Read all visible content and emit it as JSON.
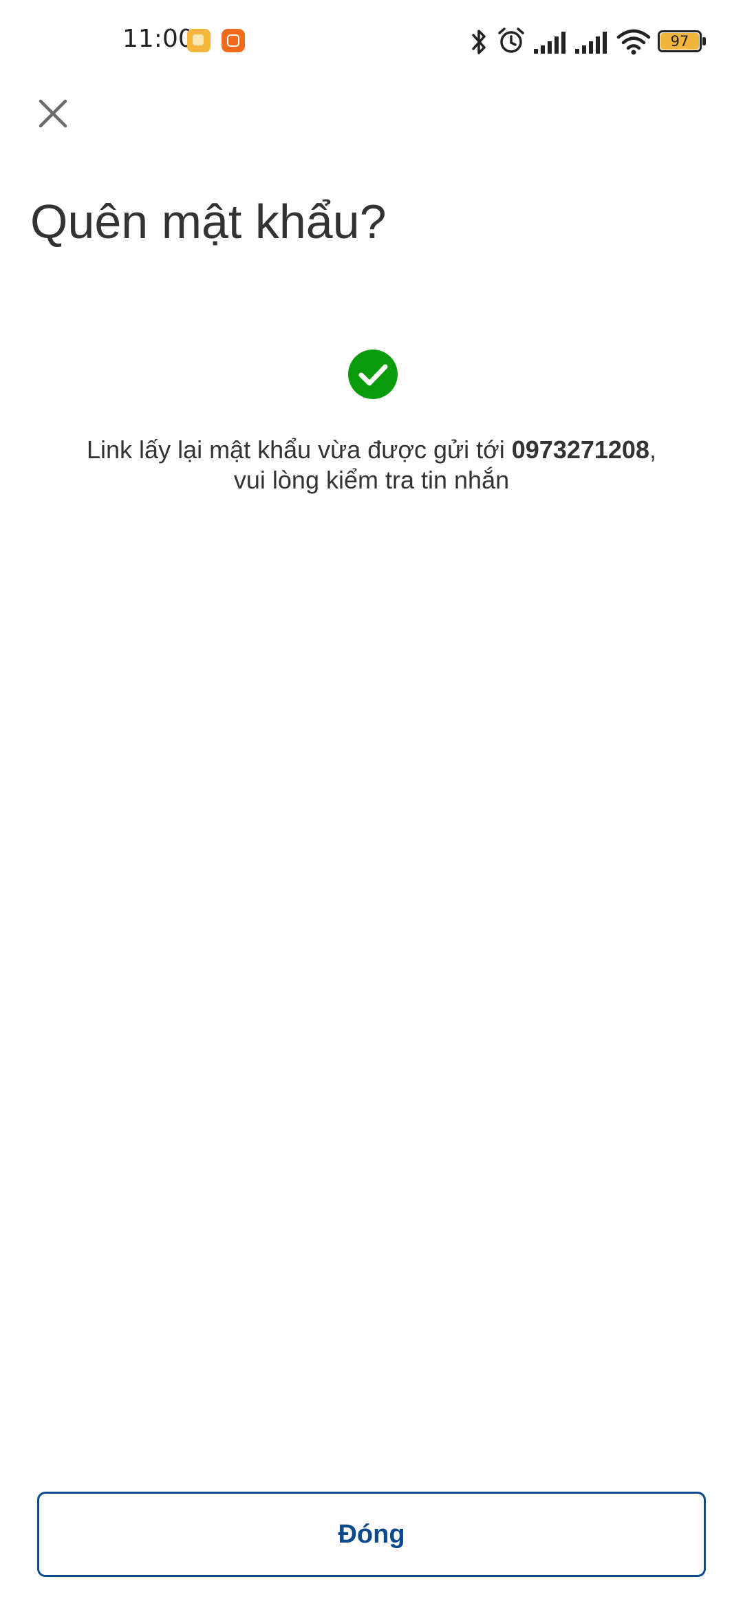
{
  "status_bar": {
    "time": "11:00",
    "battery_level": "97",
    "icons": [
      "notes-app-icon",
      "mi-app-icon",
      "bluetooth-icon",
      "alarm-icon",
      "signal-icon",
      "signal-icon",
      "wifi-icon",
      "battery-icon"
    ]
  },
  "header": {
    "close_icon": "close-icon",
    "title": "Quên mật khẩu?"
  },
  "content": {
    "success_icon": "check-circle-icon",
    "success_color": "#0a9b0a",
    "message_prefix": "Link lấy lại mật khẩu vừa được gửi tới ",
    "phone": "0973271208",
    "message_suffix": ",",
    "message_line2": "vui lòng kiểm tra tin nhắn"
  },
  "footer": {
    "close_button_label": "Đóng",
    "accent_color": "#0d4a8c"
  }
}
